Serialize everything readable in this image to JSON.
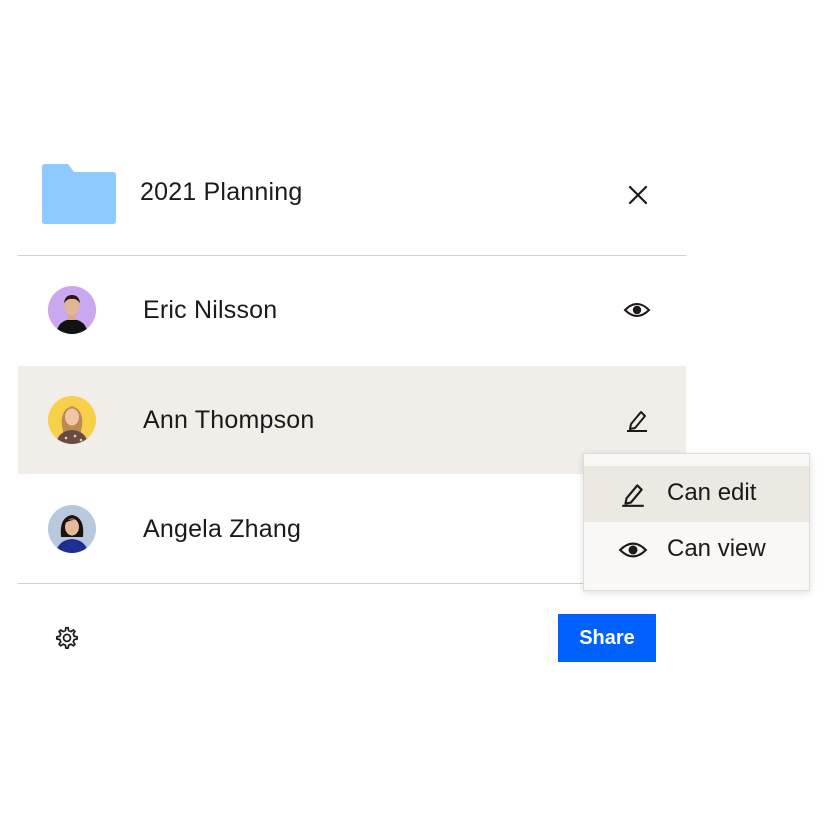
{
  "folder": {
    "name": "2021 Planning",
    "icon": "folder-icon",
    "color": "#8ec9ff"
  },
  "members": [
    {
      "name": "Eric Nilsson",
      "permission_icon": "eye-icon",
      "avatar_bg": "#c9a8f0"
    },
    {
      "name": "Ann Thompson",
      "permission_icon": "pencil-icon",
      "avatar_bg": "#f7cf4a",
      "highlighted": true
    },
    {
      "name": "Angela Zhang",
      "avatar_bg": "#b9c9dd"
    }
  ],
  "permission_menu": {
    "items": [
      {
        "label": "Can edit",
        "icon": "pencil-icon",
        "active": true
      },
      {
        "label": "Can view",
        "icon": "eye-icon"
      }
    ]
  },
  "footer": {
    "settings_icon": "gear-icon",
    "share_label": "Share"
  },
  "colors": {
    "accent": "#0061fe",
    "highlight_row": "#f1eeea",
    "divider": "#d4d0cb"
  }
}
